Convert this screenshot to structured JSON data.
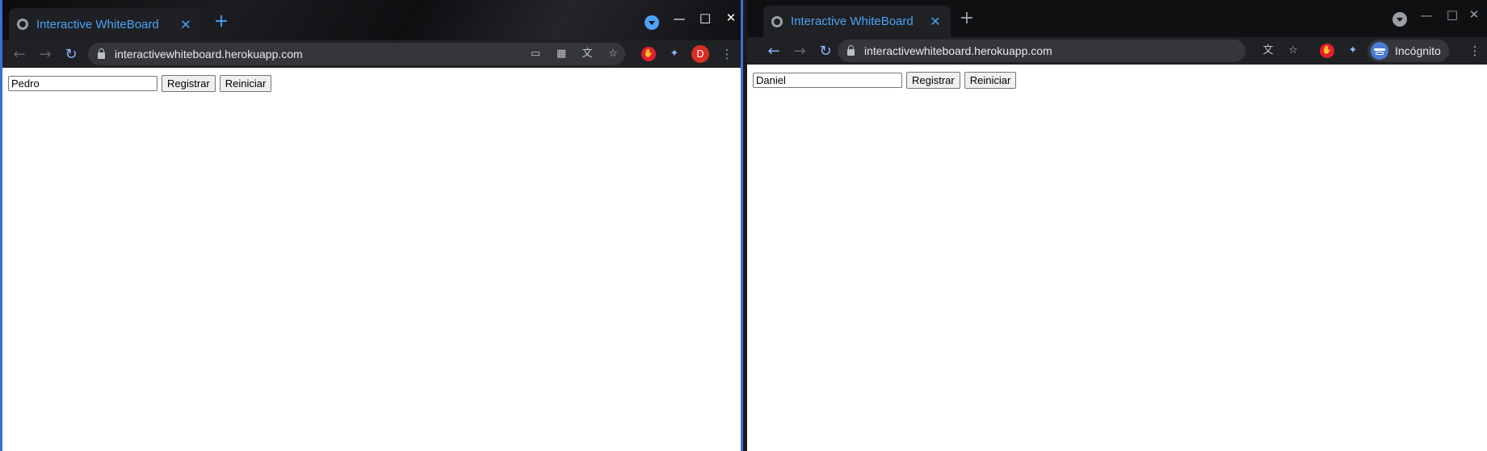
{
  "left_window": {
    "tab_title": "Interactive WhiteBoard",
    "url": "interactivewhiteboard.herokuapp.com",
    "profile_initial": "D",
    "page": {
      "name_value": "Pedro",
      "register_label": "Registrar",
      "reset_label": "Reiniciar"
    }
  },
  "right_window": {
    "tab_title": "Interactive WhiteBoard",
    "url": "interactivewhiteboard.herokuapp.com",
    "incognito_label": "Incógnito",
    "page": {
      "name_value": "Daniel",
      "register_label": "Registrar",
      "reset_label": "Reiniciar"
    }
  },
  "colors": {
    "accent_blue": "#4ba3f5",
    "incognito_blue": "#4b7bd6",
    "profile_red": "#d93025",
    "extension_red": "#e21e31"
  },
  "icons": [
    "globe-icon",
    "close-icon",
    "plus-icon",
    "minimize-icon",
    "maximize-icon",
    "back-icon",
    "forward-icon",
    "reload-icon",
    "lock-icon",
    "cast-icon",
    "qr-icon",
    "translate-icon",
    "star-icon",
    "adblock-icon",
    "puzzle-icon",
    "kebab-menu-icon",
    "incognito-icon",
    "tab-search-icon"
  ]
}
